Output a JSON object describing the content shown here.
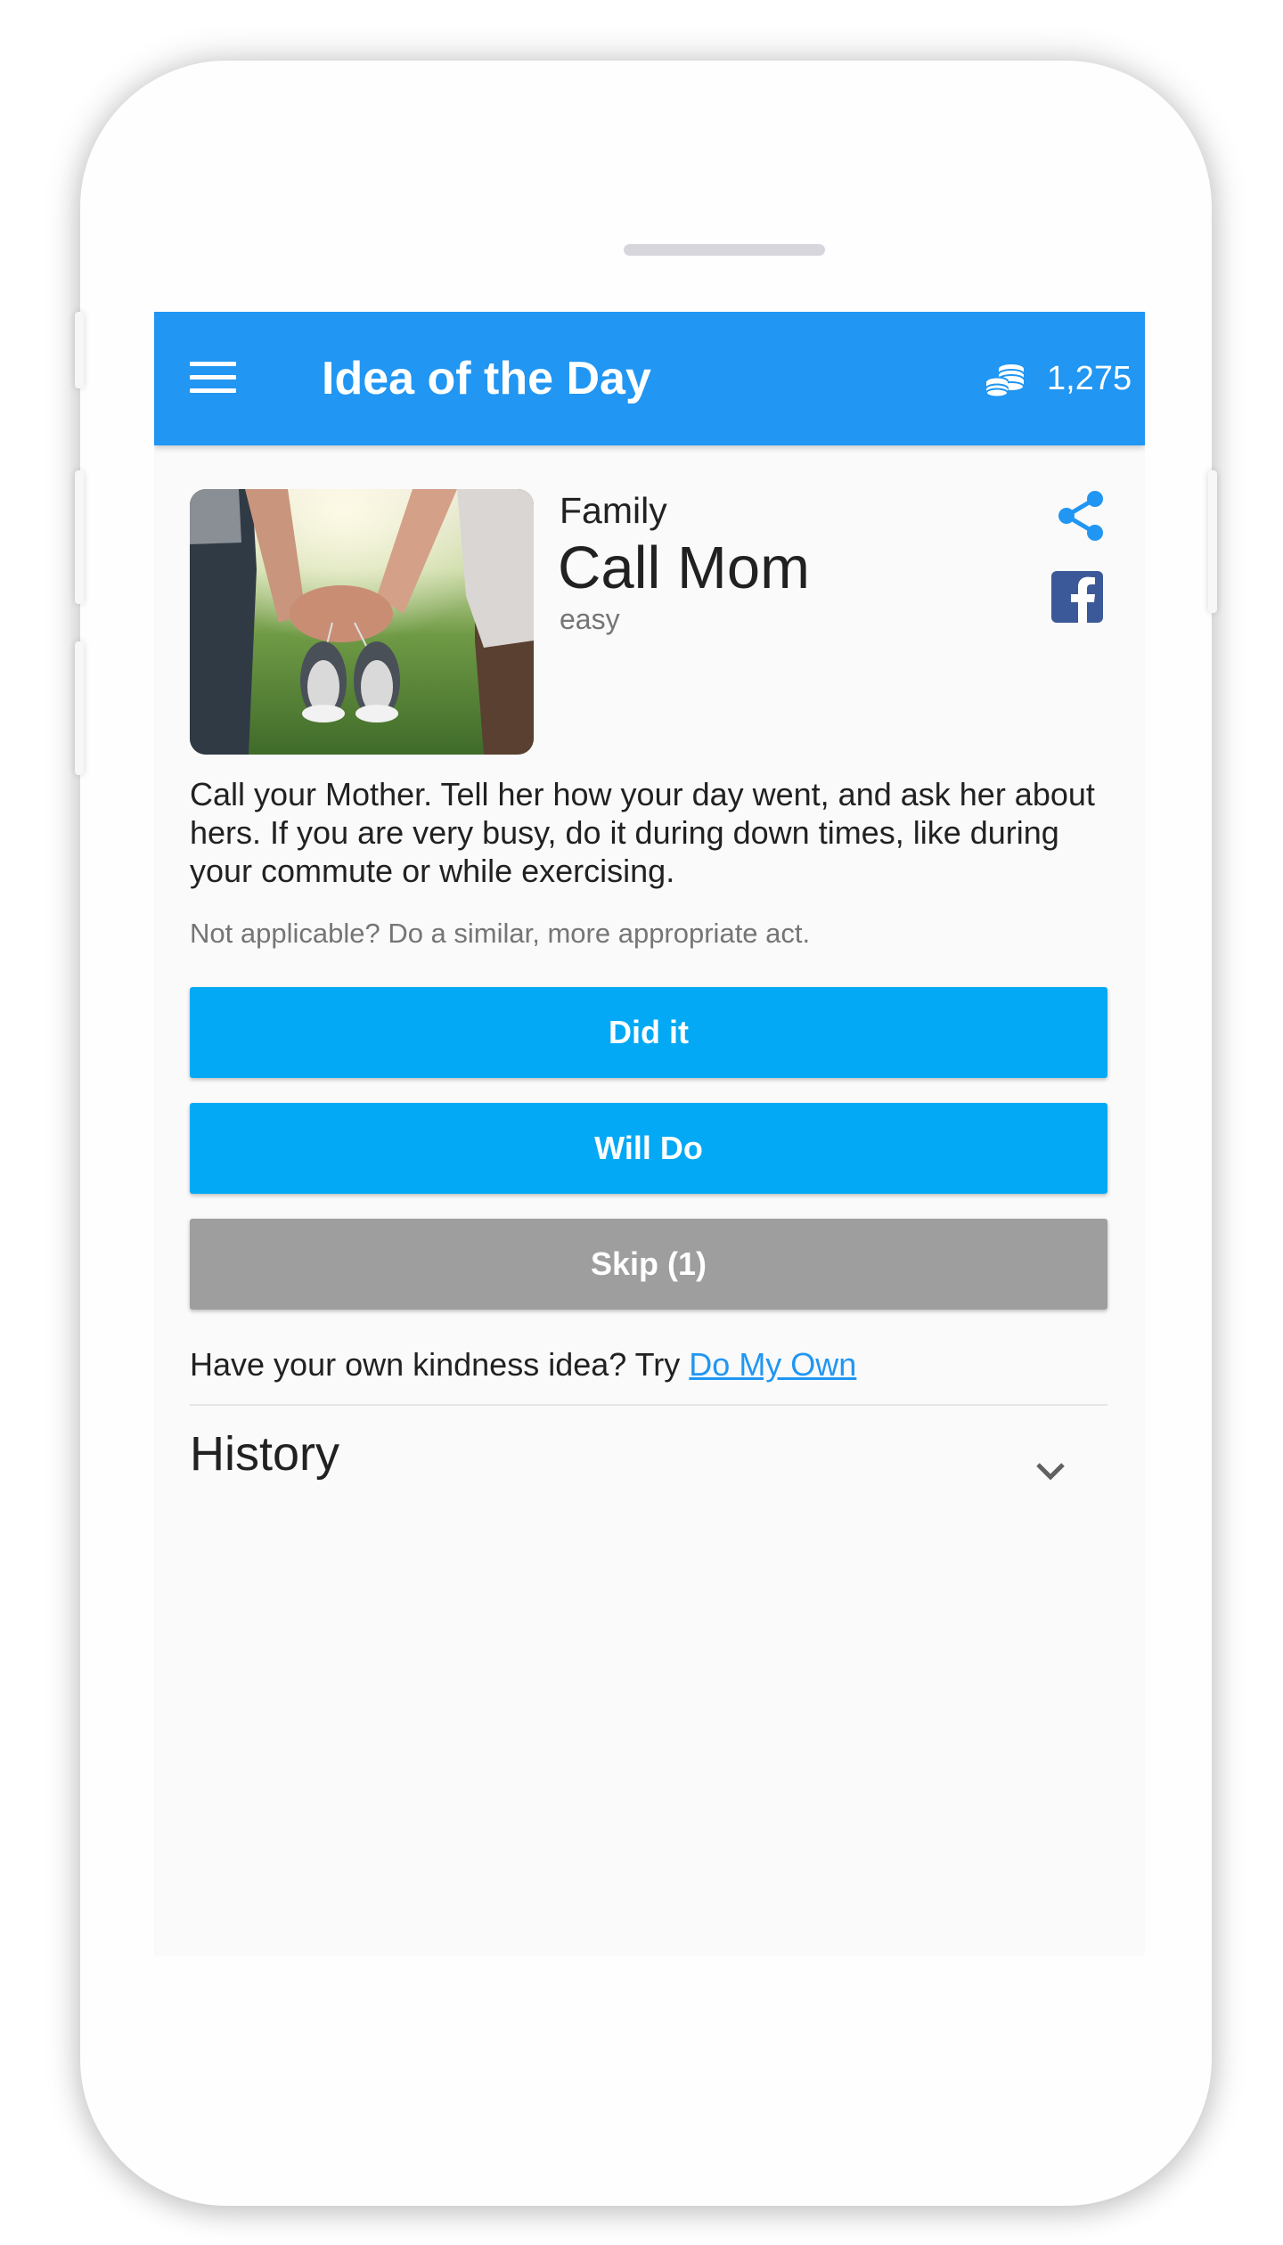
{
  "app_bar": {
    "title": "Idea of the Day",
    "coins": "1,275",
    "menu_icon": "hamburger-menu-icon",
    "coins_icon": "coin-stack-icon",
    "color": "#2196f3"
  },
  "idea": {
    "category": "Family",
    "title": "Call Mom",
    "difficulty": "easy",
    "description": "Call your Mother. Tell her how your day went, and ask her about hers. If you are very busy, do it during down times, like during your commute or while exercising.",
    "note": "Not applicable? Do a similar, more appropriate act.",
    "share_icon": "share-icon",
    "facebook_icon": "facebook-icon"
  },
  "actions": {
    "did_it": "Did it",
    "will_do": "Will Do",
    "skip": "Skip (1)",
    "primary_color": "#03a9f4",
    "skip_color": "#9e9e9e"
  },
  "own_idea": {
    "prompt": "Have your own kindness idea? Try ",
    "link": "Do My Own",
    "link_color": "#2196f3"
  },
  "history": {
    "title": "History",
    "expanded": false,
    "toggle_icon": "chevron-down-icon"
  }
}
